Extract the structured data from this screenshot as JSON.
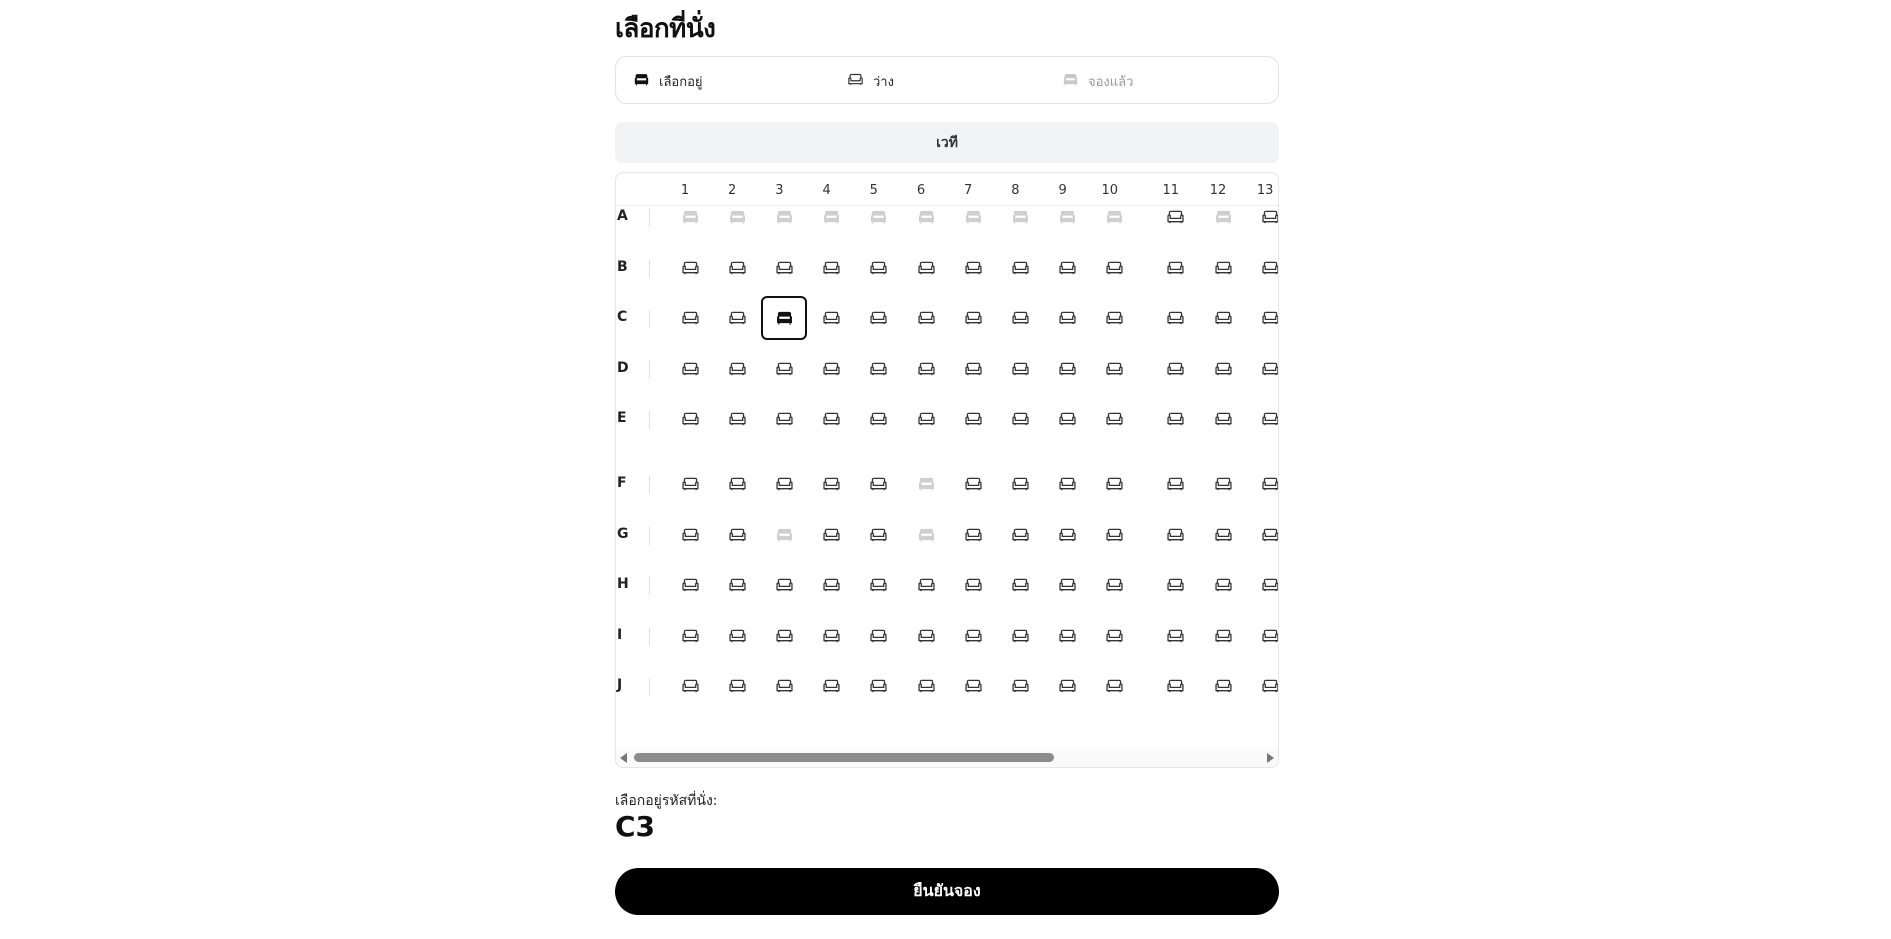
{
  "page": {
    "title": "เลือกที่นั่ง"
  },
  "legend": {
    "selected": {
      "label": "เลือกอยู่",
      "icon": "seat-filled-icon"
    },
    "available": {
      "label": "ว่าง",
      "icon": "seat-outline-icon"
    },
    "booked": {
      "label": "จองแล้ว",
      "icon": "seat-booked-icon"
    }
  },
  "stage": {
    "label": "เวที"
  },
  "seat_map": {
    "columns": [
      "1",
      "2",
      "3",
      "4",
      "5",
      "6",
      "7",
      "8",
      "9",
      "10",
      "11",
      "12",
      "13"
    ],
    "rows": [
      {
        "label": "A",
        "seats": [
          "booked",
          "booked",
          "booked",
          "booked",
          "booked",
          "booked",
          "booked",
          "booked",
          "booked",
          "booked",
          "available",
          "booked",
          "available"
        ]
      },
      {
        "label": "B",
        "seats": [
          "available",
          "available",
          "available",
          "available",
          "available",
          "available",
          "available",
          "available",
          "available",
          "available",
          "available",
          "available",
          "available"
        ]
      },
      {
        "label": "C",
        "seats": [
          "available",
          "available",
          "selected",
          "available",
          "available",
          "available",
          "available",
          "available",
          "available",
          "available",
          "available",
          "available",
          "available"
        ]
      },
      {
        "label": "D",
        "seats": [
          "available",
          "available",
          "available",
          "available",
          "available",
          "available",
          "available",
          "available",
          "available",
          "available",
          "available",
          "available",
          "available"
        ]
      },
      {
        "label": "E",
        "seats": [
          "available",
          "available",
          "available",
          "available",
          "available",
          "available",
          "available",
          "available",
          "available",
          "available",
          "available",
          "available",
          "available"
        ]
      },
      {
        "label": "F",
        "seats": [
          "available",
          "available",
          "available",
          "available",
          "available",
          "booked",
          "available",
          "available",
          "available",
          "available",
          "available",
          "available",
          "available"
        ]
      },
      {
        "label": "G",
        "seats": [
          "available",
          "available",
          "booked",
          "available",
          "available",
          "booked",
          "available",
          "available",
          "available",
          "available",
          "available",
          "available",
          "available"
        ]
      },
      {
        "label": "H",
        "seats": [
          "available",
          "available",
          "available",
          "available",
          "available",
          "available",
          "available",
          "available",
          "available",
          "available",
          "available",
          "available",
          "available"
        ]
      },
      {
        "label": "I",
        "seats": [
          "available",
          "available",
          "available",
          "available",
          "available",
          "available",
          "available",
          "available",
          "available",
          "available",
          "available",
          "available",
          "available"
        ]
      },
      {
        "label": "J",
        "seats": [
          "available",
          "available",
          "available",
          "available",
          "available",
          "available",
          "available",
          "available",
          "available",
          "available",
          "available",
          "available",
          "available"
        ]
      }
    ],
    "colors": {
      "available": "#333333",
      "booked": "#cfcfcf",
      "selected": "#111111"
    }
  },
  "selection": {
    "label": "เลือกอยู่รหัสที่นั่ง:",
    "code": "C3"
  },
  "confirm": {
    "label": "ยืนยันจอง"
  }
}
